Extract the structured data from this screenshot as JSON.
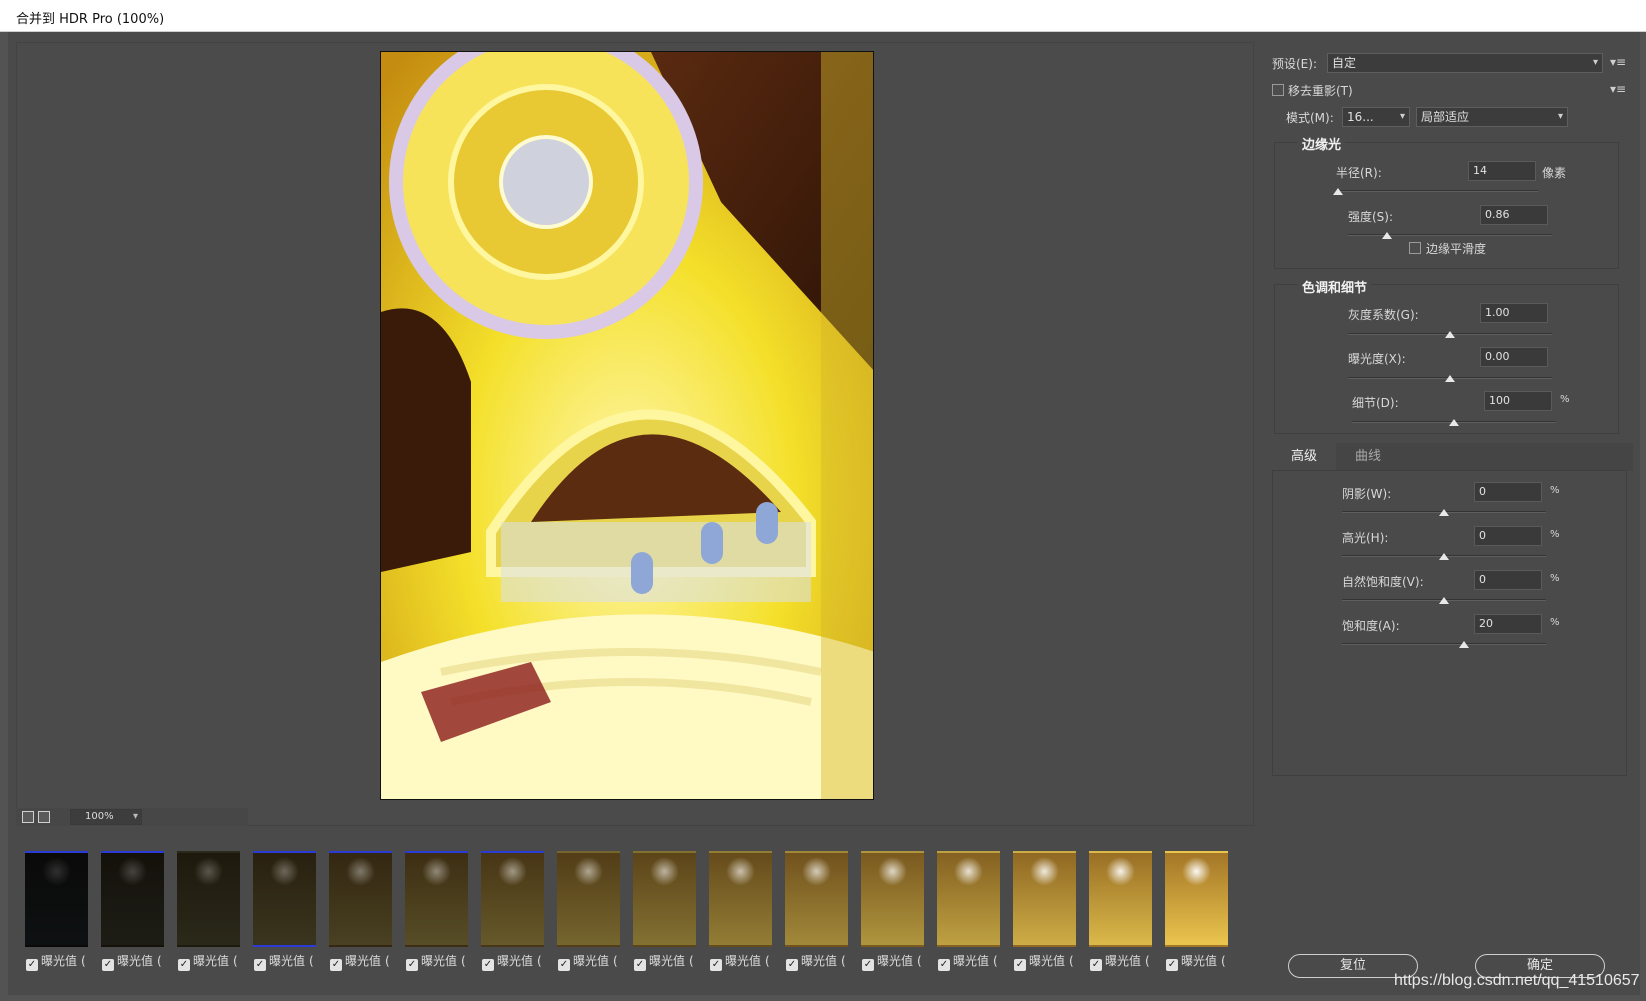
{
  "window": {
    "title": "合并到 HDR Pro (100%)"
  },
  "zoom": {
    "value": "100%"
  },
  "thumbnails": {
    "label": "曝光值",
    "suffix": "(",
    "count": 16
  },
  "preset": {
    "label": "预设(E):",
    "value": "自定"
  },
  "remove_ghosts": {
    "label": "移去重影(T)",
    "checked": false
  },
  "mode": {
    "label": "模式(M):",
    "bit_depth": "16...",
    "method": "局部适应"
  },
  "edge_glow": {
    "title": "边缘光",
    "radius": {
      "label": "半径(R):",
      "value": "14",
      "unit": "像素",
      "level": 0.0
    },
    "strength": {
      "label": "强度(S):",
      "value": "0.86",
      "level": 0.19
    },
    "smooth_edges": {
      "label": "边缘平滑度",
      "checked": false
    }
  },
  "tone_detail": {
    "title": "色调和细节",
    "gamma": {
      "label": "灰度系数(G):",
      "value": "1.00",
      "level": 0.5
    },
    "exposure": {
      "label": "曝光度(X):",
      "value": "0.00",
      "level": 0.5
    },
    "detail": {
      "label": "细节(D):",
      "value": "100",
      "unit": "%",
      "level": 0.5
    }
  },
  "tabs": [
    {
      "label": "高级",
      "active": true
    },
    {
      "label": "曲线",
      "active": false
    }
  ],
  "advanced": {
    "shadow": {
      "label": "阴影(W):",
      "value": "0",
      "unit": "%",
      "level": 0.5
    },
    "highlight": {
      "label": "高光(H):",
      "value": "0",
      "unit": "%",
      "level": 0.5
    },
    "vibrance": {
      "label": "自然饱和度(V):",
      "value": "0",
      "unit": "%",
      "level": 0.5
    },
    "saturation": {
      "label": "饱和度(A):",
      "value": "20",
      "unit": "%",
      "level": 0.6
    }
  },
  "buttons": {
    "reset": "复位",
    "ok": "确定"
  },
  "watermark": "https://blog.csdn.net/qq_41510657",
  "colors": {
    "selection_border": "#2a3bd6",
    "panel_bg": "#4a4a4a"
  }
}
